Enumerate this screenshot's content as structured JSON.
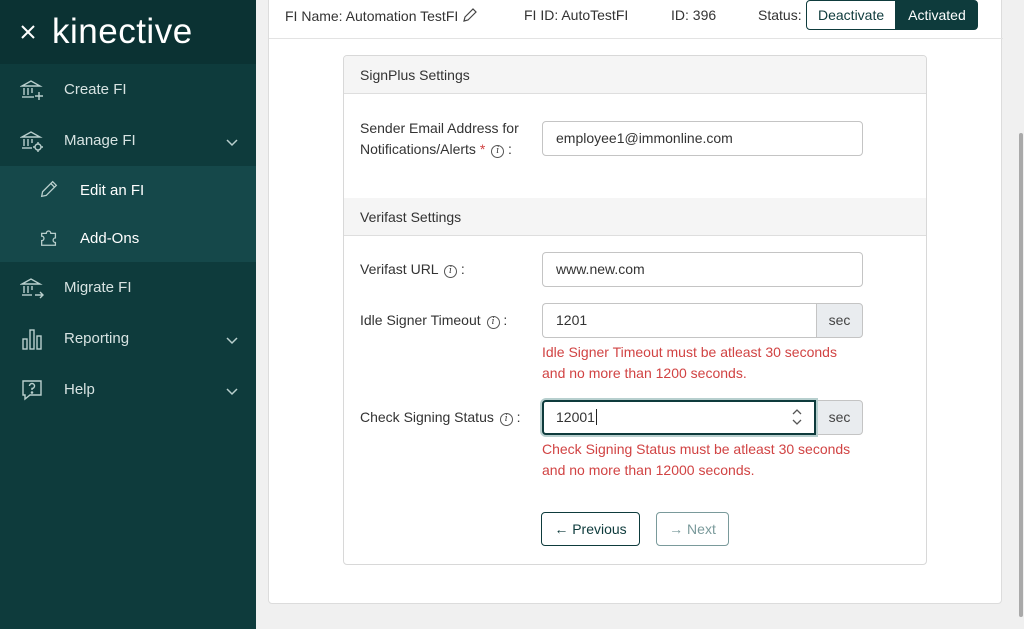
{
  "brand": {
    "name": "kinective"
  },
  "nav": {
    "create_fi": "Create FI",
    "manage_fi": "Manage FI",
    "edit_fi": "Edit an FI",
    "add_ons": "Add-Ons",
    "migrate_fi": "Migrate FI",
    "reporting": "Reporting",
    "help": "Help"
  },
  "header": {
    "fi_name": "FI Name: Automation TestFI",
    "fi_id": "FI ID: AutoTestFI",
    "id": "ID: 396",
    "status_label": "Status:",
    "deactivate": "Deactivate",
    "activated": "Activated"
  },
  "signplus": {
    "title": "SignPlus Settings",
    "sender_label_line1": "Sender Email Address for",
    "sender_label_line2": "Notifications/Alerts",
    "sender_value": "employee1@immonline.com"
  },
  "verifast": {
    "title": "Verifast Settings",
    "url_label": "Verifast URL",
    "url_value": "www.new.com",
    "idle_label": "Idle Signer Timeout",
    "idle_value": "1201",
    "idle_unit": "sec",
    "idle_error_line1": "Idle Signer Timeout must be atleast 30 seconds",
    "idle_error_line2": "and no more than 1200 seconds.",
    "check_label": "Check Signing Status",
    "check_value": "12001",
    "check_unit": "sec",
    "check_error_line1": "Check Signing Status must be atleast 30 seconds",
    "check_error_line2": "and no more than 12000 seconds."
  },
  "buttons": {
    "previous": "Previous",
    "next": "Next"
  }
}
